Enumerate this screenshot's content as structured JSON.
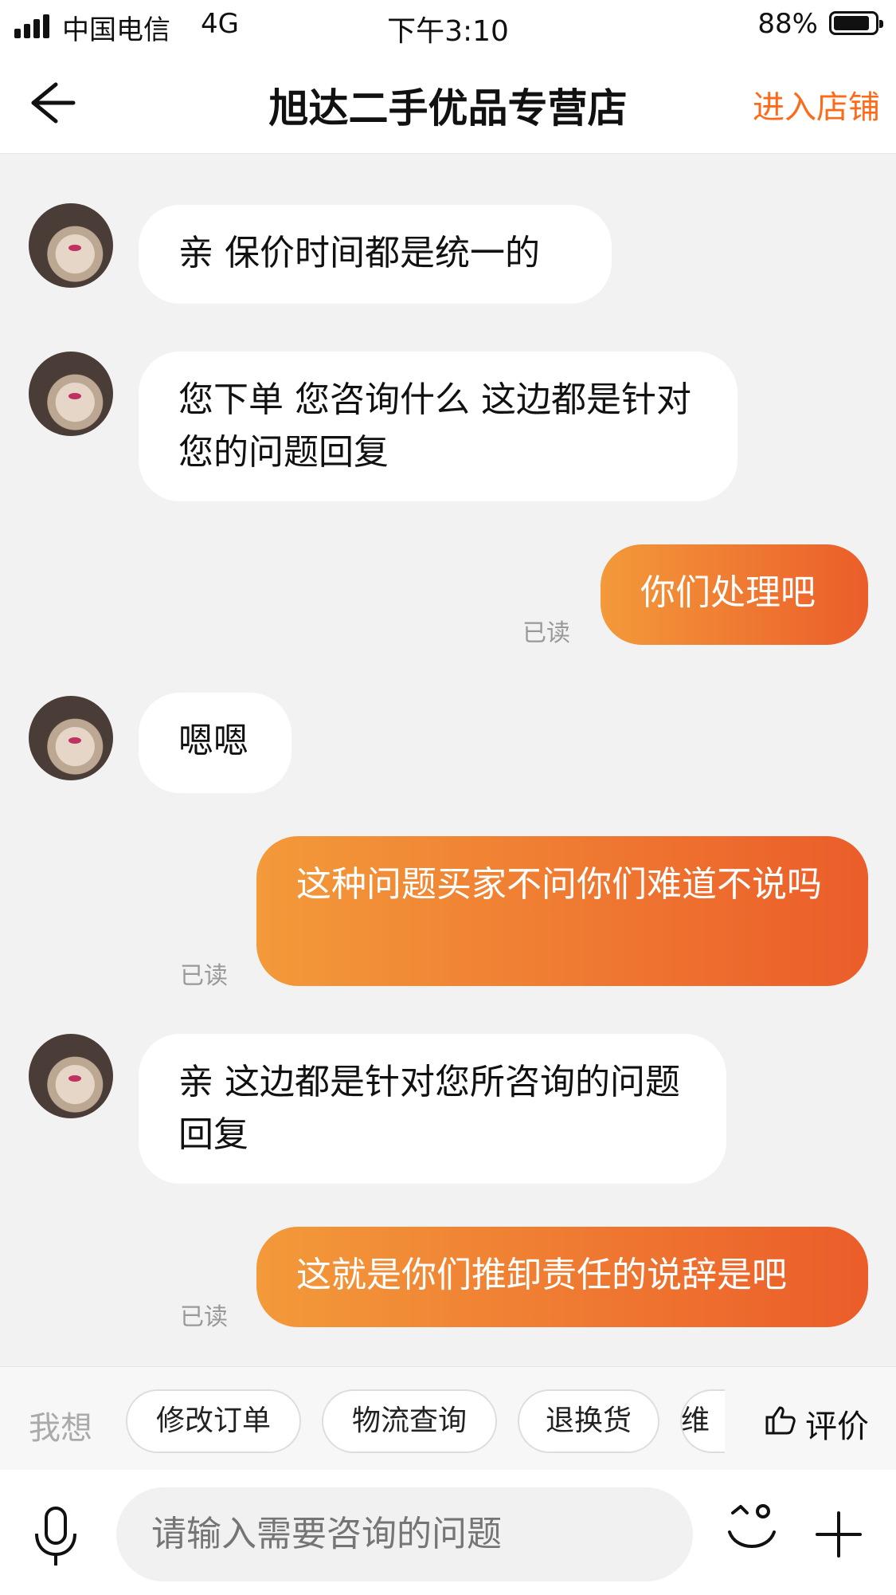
{
  "status_bar": {
    "carrier": "中国电信",
    "network": "4G",
    "time": "下午3:10",
    "battery_percent": "88%",
    "battery_level": 0.88
  },
  "nav": {
    "back_icon": "back-arrow-icon",
    "title": "旭达二手优品专营店",
    "enter_shop": "进入店铺"
  },
  "messages": [
    {
      "side": "left",
      "text": "亲 保价时间都是统一的"
    },
    {
      "side": "left",
      "text": "您下单 您咨询什么 这边都是针对您的问题回复"
    },
    {
      "side": "right",
      "text": "你们处理吧",
      "read": "已读"
    },
    {
      "side": "left",
      "text": "嗯嗯"
    },
    {
      "side": "right",
      "text": "这种问题买家不问你们难道不说吗",
      "read": "已读"
    },
    {
      "side": "left",
      "text": "亲 这边都是针对您所咨询的问题回复"
    },
    {
      "side": "right",
      "text": "这就是你们推卸责任的说辞是吧",
      "read": "已读"
    }
  ],
  "quick_replies": {
    "label": "我想",
    "chips": [
      "修改订单",
      "物流查询",
      "退换货",
      "维"
    ],
    "rate": "评价",
    "rate_icon": "thumbs-up-icon"
  },
  "input": {
    "placeholder": "请输入需要咨询的问题",
    "mic_icon": "microphone-icon",
    "emoji_icon": "emoji-icon",
    "plus_icon": "plus-icon"
  },
  "colors": {
    "accent": "#ff6a1a",
    "bubble_gradient_start": "#f39a3a",
    "bubble_gradient_end": "#eb5d2a"
  }
}
